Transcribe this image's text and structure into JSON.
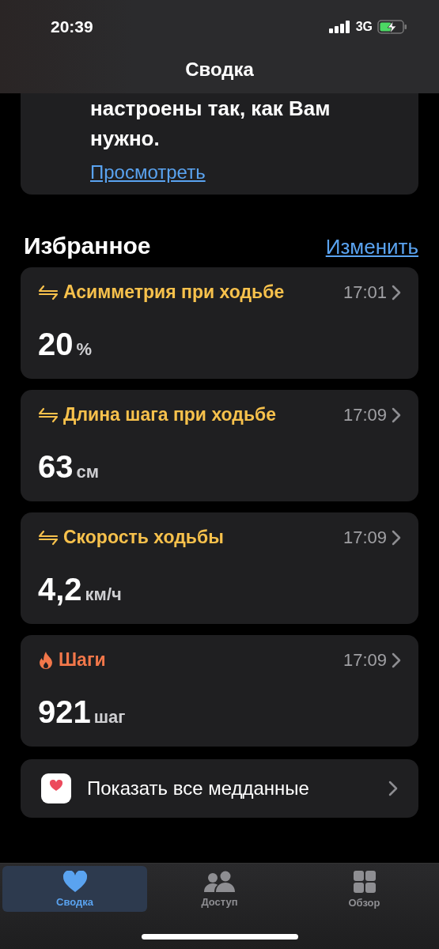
{
  "status_bar": {
    "time": "20:39",
    "network": "3G"
  },
  "nav": {
    "title": "Сводка"
  },
  "notice": {
    "text": "настроены так, как Вам нужно.",
    "link": "Просмотреть"
  },
  "favorites": {
    "title": "Избранное",
    "edit": "Изменить",
    "items": [
      {
        "kind": "mobility",
        "color": "#f7c14c",
        "title": "Асимметрия при ходьбе",
        "time": "17:01",
        "value": "20",
        "unit": "%"
      },
      {
        "kind": "mobility",
        "color": "#f7c14c",
        "title": "Длина шага при ходьбе",
        "time": "17:09",
        "value": "63",
        "unit": "см"
      },
      {
        "kind": "mobility",
        "color": "#f7c14c",
        "title": "Скорость ходьбы",
        "time": "17:09",
        "value": "4,2",
        "unit": "км/ч"
      },
      {
        "kind": "activity",
        "color": "#f2774a",
        "title": "Шаги",
        "time": "17:09",
        "value": "921",
        "unit": "шаг"
      }
    ],
    "show_all": "Показать все медданные"
  },
  "tabs": [
    {
      "kind": "summary",
      "label": "Сводка",
      "selected": true
    },
    {
      "kind": "sharing",
      "label": "Доступ",
      "selected": false
    },
    {
      "kind": "browse",
      "label": "Обзор",
      "selected": false
    }
  ]
}
